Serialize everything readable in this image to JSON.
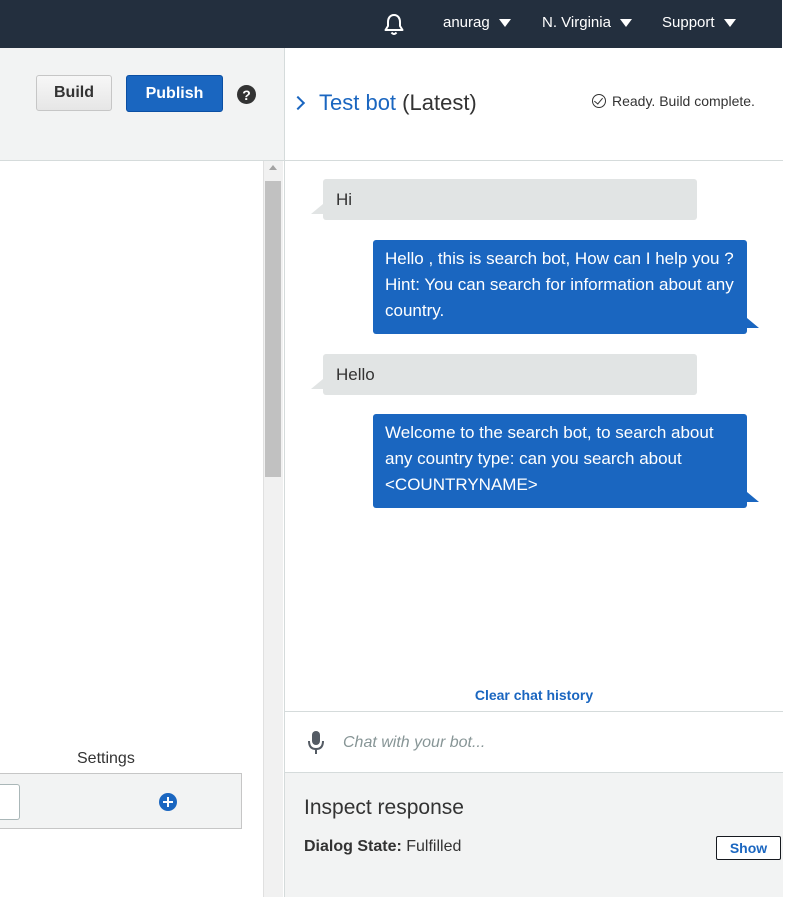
{
  "topnav": {
    "user": "anurag",
    "region": "N. Virginia",
    "support": "Support"
  },
  "toolbar": {
    "build_label": "Build",
    "publish_label": "Publish",
    "help_glyph": "?"
  },
  "left": {
    "settings_label": "Settings"
  },
  "testbot": {
    "title": "Test bot",
    "title_suffix": "(Latest)",
    "status": "Ready. Build complete.",
    "messages": [
      {
        "from": "user",
        "text": "Hi"
      },
      {
        "from": "bot",
        "text": "Hello , this is search bot, How can I help you ? Hint: You can search for information about any country."
      },
      {
        "from": "user",
        "text": "Hello"
      },
      {
        "from": "bot",
        "text": "Welcome to the search bot, to search about any country type: can you search about <COUNTRYNAME>"
      }
    ],
    "clear_history": "Clear chat history",
    "input_placeholder": "Chat with your bot...",
    "inspect_title": "Inspect response",
    "dialog_state_key": "Dialog State:",
    "dialog_state_value": "Fulfilled",
    "show_label": "Show"
  },
  "colors": {
    "nav_bg": "#232f3e",
    "primary_blue": "#1a66c0",
    "user_bubble": "#e1e4e4",
    "panel_gray": "#f2f3f3"
  },
  "icons": [
    "bell-icon",
    "caret-down-icon",
    "help-icon",
    "chevron-right-icon",
    "check-circle-icon",
    "add-icon",
    "microphone-icon"
  ]
}
